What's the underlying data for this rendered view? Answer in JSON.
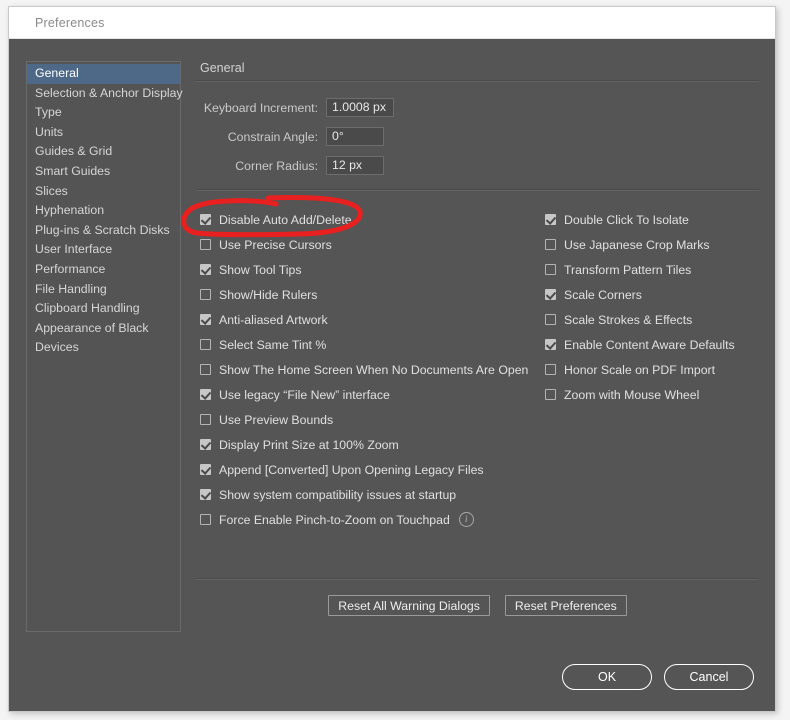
{
  "window": {
    "title": "Preferences"
  },
  "sidebar": {
    "items": [
      {
        "label": "General",
        "selected": true
      },
      {
        "label": "Selection & Anchor Display",
        "selected": false
      },
      {
        "label": "Type",
        "selected": false
      },
      {
        "label": "Units",
        "selected": false
      },
      {
        "label": "Guides & Grid",
        "selected": false
      },
      {
        "label": "Smart Guides",
        "selected": false
      },
      {
        "label": "Slices",
        "selected": false
      },
      {
        "label": "Hyphenation",
        "selected": false
      },
      {
        "label": "Plug-ins & Scratch Disks",
        "selected": false
      },
      {
        "label": "User Interface",
        "selected": false
      },
      {
        "label": "Performance",
        "selected": false
      },
      {
        "label": "File Handling",
        "selected": false
      },
      {
        "label": "Clipboard Handling",
        "selected": false
      },
      {
        "label": "Appearance of Black",
        "selected": false
      },
      {
        "label": "Devices",
        "selected": false
      }
    ]
  },
  "pane": {
    "title": "General",
    "fields": [
      {
        "label": "Keyboard Increment:",
        "value": "1.0008 px"
      },
      {
        "label": "Constrain Angle:",
        "value": "0°"
      },
      {
        "label": "Corner Radius:",
        "value": "12 px"
      }
    ],
    "checkboxes_left": [
      {
        "label": "Disable Auto Add/Delete",
        "checked": true
      },
      {
        "label": "Use Precise Cursors",
        "checked": false
      },
      {
        "label": "Show Tool Tips",
        "checked": true
      },
      {
        "label": "Show/Hide Rulers",
        "checked": false
      },
      {
        "label": "Anti-aliased Artwork",
        "checked": true
      },
      {
        "label": "Select Same Tint %",
        "checked": false
      },
      {
        "label": "Show The Home Screen When No Documents Are Open",
        "checked": false
      },
      {
        "label": "Use legacy “File New” interface",
        "checked": true
      },
      {
        "label": "Use Preview Bounds",
        "checked": false
      },
      {
        "label": "Display Print Size at 100% Zoom",
        "checked": true
      },
      {
        "label": "Append [Converted] Upon Opening Legacy Files",
        "checked": true
      },
      {
        "label": "Show system compatibility issues at startup",
        "checked": true
      },
      {
        "label": "Force Enable Pinch-to-Zoom on Touchpad",
        "checked": false,
        "info": "i"
      }
    ],
    "checkboxes_right": [
      {
        "label": "Double Click To Isolate",
        "checked": true
      },
      {
        "label": "Use Japanese Crop Marks",
        "checked": false
      },
      {
        "label": "Transform Pattern Tiles",
        "checked": false
      },
      {
        "label": "Scale Corners",
        "checked": true
      },
      {
        "label": "Scale Strokes & Effects",
        "checked": false
      },
      {
        "label": "Enable Content Aware Defaults",
        "checked": true
      },
      {
        "label": "Honor Scale on PDF Import",
        "checked": false
      },
      {
        "label": "Zoom with Mouse Wheel",
        "checked": false
      }
    ],
    "reset_buttons": [
      {
        "label": "Reset All Warning Dialogs"
      },
      {
        "label": "Reset Preferences"
      }
    ]
  },
  "footer": {
    "ok_label": "OK",
    "cancel_label": "Cancel"
  },
  "annotation": {
    "color": "#e8201f",
    "target": "Disable Auto Add/Delete"
  },
  "colors": {
    "dialog_bg": "#555555",
    "titlebar_bg": "#ffffff",
    "selection_blue": "#4e6987",
    "text": "#e0e0e0",
    "annotation_red": "#e8201f"
  }
}
